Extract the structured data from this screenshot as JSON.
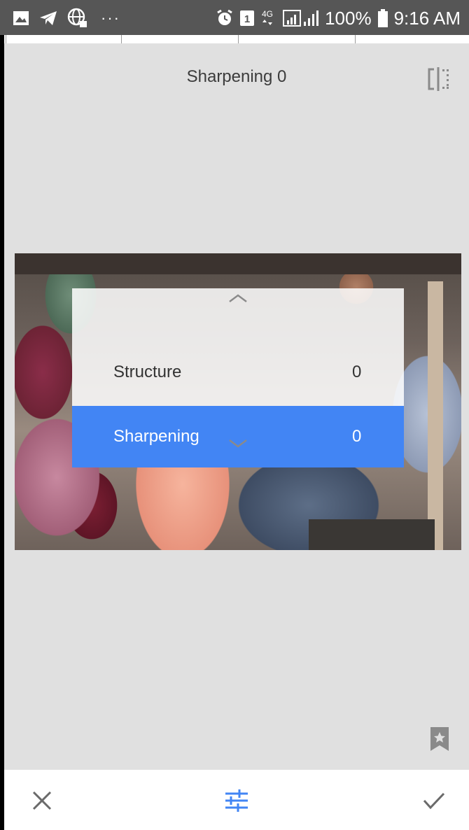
{
  "status_bar": {
    "time": "9:16 AM",
    "battery": "100%",
    "network": "4G",
    "sim": "1",
    "overflow": "···",
    "icons": [
      "image-icon",
      "telegram-icon",
      "vpn-globe-icon",
      "alarm-icon",
      "sim-icon",
      "network-4g-icon",
      "signal-icon",
      "battery-icon"
    ]
  },
  "header": {
    "title": "Sharpening 0",
    "compare_icon": "compare-icon"
  },
  "adjust_menu": {
    "items": [
      {
        "label": "Structure",
        "value": "0",
        "selected": false
      },
      {
        "label": "Sharpening",
        "value": "0",
        "selected": true
      }
    ],
    "accent": "#4285f4"
  },
  "photo": {
    "description_icon": "photo"
  },
  "bottom_bar": {
    "icons": [
      "close-icon",
      "tune-icon",
      "check-icon"
    ],
    "accent": "#4285f4"
  }
}
